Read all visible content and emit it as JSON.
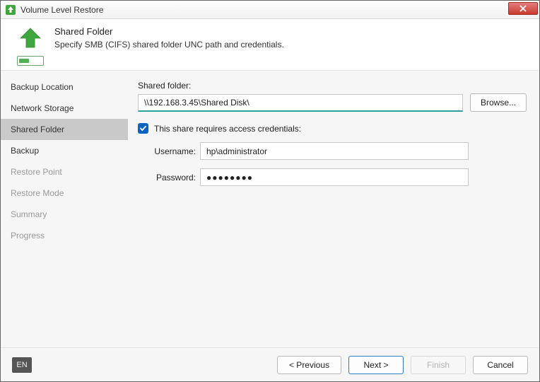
{
  "window": {
    "title": "Volume Level Restore"
  },
  "header": {
    "title": "Shared Folder",
    "description": "Specify SMB (CIFS) shared folder UNC path and credentials."
  },
  "nav": {
    "items": [
      {
        "label": "Backup Location",
        "state": "normal"
      },
      {
        "label": "Network Storage",
        "state": "normal"
      },
      {
        "label": "Shared Folder",
        "state": "active"
      },
      {
        "label": "Backup",
        "state": "normal"
      },
      {
        "label": "Restore Point",
        "state": "disabled"
      },
      {
        "label": "Restore Mode",
        "state": "disabled"
      },
      {
        "label": "Summary",
        "state": "disabled"
      },
      {
        "label": "Progress",
        "state": "disabled"
      }
    ]
  },
  "form": {
    "shared_folder_label": "Shared folder:",
    "shared_folder_value": "\\\\192.168.3.45\\Shared Disk\\",
    "browse_label": "Browse...",
    "requires_credentials_checked": true,
    "requires_credentials_label": "This share requires access credentials:",
    "username_label": "Username:",
    "username_value": "hp\\administrator",
    "password_label": "Password:",
    "password_value": "●●●●●●●●"
  },
  "footer": {
    "lang": "EN",
    "previous": "< Previous",
    "next": "Next >",
    "finish": "Finish",
    "cancel": "Cancel"
  },
  "colors": {
    "accent": "#29a19c",
    "check": "#0a64c2",
    "arrow": "#3fa63f"
  }
}
